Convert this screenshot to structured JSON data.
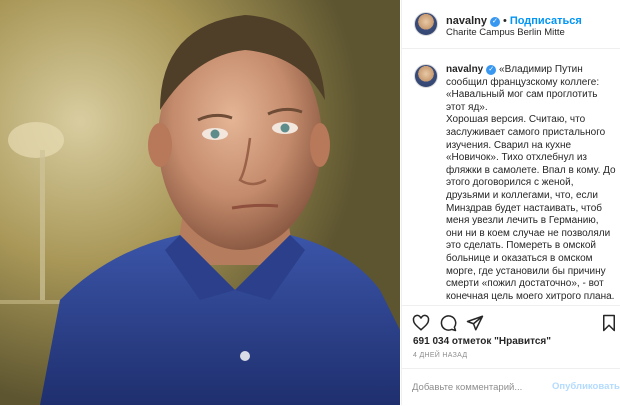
{
  "post": {
    "photo_alt": "portrait photo",
    "header": {
      "username": "navalny",
      "verified_icon": "verified-badge-icon",
      "follow_label": "Подписаться",
      "location": "Charite Campus Berlin Mitte"
    },
    "caption": {
      "username": "navalny",
      "text": "«Владимир Путин сообщил французскому коллеге: «Навальный мог сам проглотить этот яд».\nХорошая версия. Считаю, что заслуживает самого пристального изучения. Сварил на кухне «Новичок». Тихо отхлебнул из фляжки в самолете. Впал в кому. До этого договорился с женой, друзьями и коллегами, что, если Минздрав будет настаивать, чтоб меня увезли лечить в Германию, они ни в коем случае не позволяли это сделать. Помереть в омской больнице и оказаться в омском морге, где установили бы причину смерти «пожил достаточно», - вот конечная цель моего хитрого плана. Но Путин меня переиграл. Его"
    },
    "actions": {
      "like_icon": "heart-icon",
      "comment_icon": "comment-icon",
      "share_icon": "share-icon",
      "save_icon": "bookmark-icon"
    },
    "likes_text": "691 034 отметок \"Нравится\"",
    "time_ago": "4 ДНЕЙ НАЗАД",
    "comment": {
      "placeholder": "Добавьте комментарий...",
      "publish_label": "Опубликовать"
    }
  },
  "colors": {
    "accent": "#0095f6",
    "verified": "#3897f0",
    "border": "#efefef",
    "muted": "#8e8e8e",
    "publish_disabled": "#b3dbff"
  }
}
